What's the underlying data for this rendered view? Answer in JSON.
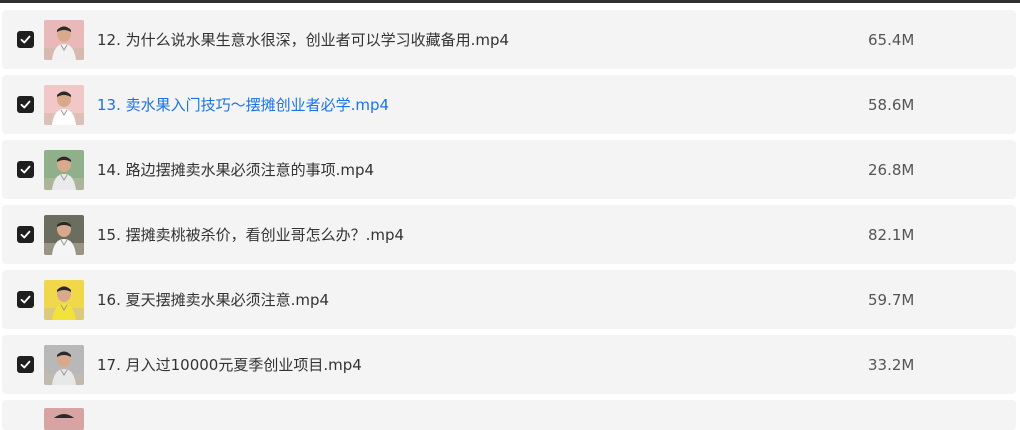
{
  "files": [
    {
      "name": "12. 为什么说水果生意水很深，创业者可以学习收藏备用.mp4",
      "size": "65.4M",
      "checked": true,
      "active": false,
      "thumb_bg": "#e9b9b9",
      "shirt": "#f2f2f2"
    },
    {
      "name": "13. 卖水果入门技巧～摆摊创业者必学.mp4",
      "size": "58.6M",
      "checked": true,
      "active": true,
      "thumb_bg": "#f1c7c7",
      "shirt": "#ffffff"
    },
    {
      "name": "14. 路边摆摊卖水果必须注意的事项.mp4",
      "size": "26.8M",
      "checked": true,
      "active": false,
      "thumb_bg": "#8fb08a",
      "shirt": "#eaeaea"
    },
    {
      "name": "15. 摆摊卖桃被杀价，看创业哥怎么办？.mp4",
      "size": "82.1M",
      "checked": true,
      "active": false,
      "thumb_bg": "#6b6e5e",
      "shirt": "#f5f5f5"
    },
    {
      "name": "16. 夏天摆摊卖水果必须注意.mp4",
      "size": "59.7M",
      "checked": true,
      "active": false,
      "thumb_bg": "#f0d84a",
      "shirt": "#f2e23b"
    },
    {
      "name": "17. 月入过10000元夏季创业项目.mp4",
      "size": "33.2M",
      "checked": true,
      "active": false,
      "thumb_bg": "#b8b8b8",
      "shirt": "#e8e8e8"
    }
  ],
  "colors": {
    "active_link": "#1a73e8",
    "row_bg": "#f4f4f4"
  }
}
